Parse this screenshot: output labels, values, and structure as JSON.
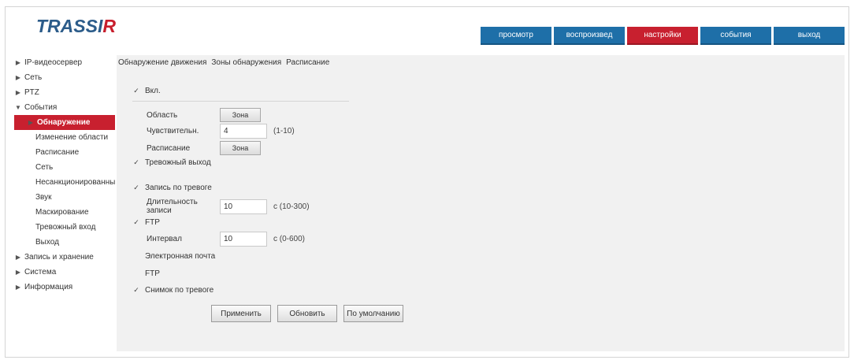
{
  "app": {
    "logo_main": "TRASSI",
    "logo_accent": "R"
  },
  "topnav": [
    {
      "label": "просмотр",
      "active": false
    },
    {
      "label": "воспроизвед",
      "active": false
    },
    {
      "label": "настройки",
      "active": true
    },
    {
      "label": "события",
      "active": false
    },
    {
      "label": "выход",
      "active": false
    }
  ],
  "sidebar": {
    "items": [
      {
        "label": "IP-видеосервер",
        "level": 1,
        "toggle": "▶"
      },
      {
        "label": "Сеть",
        "level": 1,
        "toggle": "▶"
      },
      {
        "label": "PTZ",
        "level": 1,
        "toggle": "▶"
      },
      {
        "label": "События",
        "level": 1,
        "toggle": "▼"
      },
      {
        "label": "Обнаружение",
        "level": 2,
        "toggle": "▶",
        "active": true
      },
      {
        "label": "Изменение области",
        "level": 2
      },
      {
        "label": "Расписание",
        "level": 2
      },
      {
        "label": "Сеть",
        "level": 2
      },
      {
        "label": "Несанкционированный",
        "level": 2
      },
      {
        "label": "Звук",
        "level": 2
      },
      {
        "label": "Маскирование",
        "level": 2
      },
      {
        "label": "Тревожный вход",
        "level": 2
      },
      {
        "label": "Выход",
        "level": 2
      },
      {
        "label": "Запись и хранение",
        "level": 1,
        "toggle": "▶"
      },
      {
        "label": "Система",
        "level": 1,
        "toggle": "▶"
      },
      {
        "label": "Информация",
        "level": 1,
        "toggle": "▶"
      }
    ]
  },
  "breadcrumb": {
    "parts": [
      "Обнаружение движения",
      "Зоны обнаружения",
      "Расписание"
    ]
  },
  "form": {
    "enable": {
      "label": "Вкл.",
      "checked": true
    },
    "area": {
      "label": "Область",
      "button": "Зона"
    },
    "sensitivity": {
      "label": "Чувствительн.",
      "value": "4",
      "hint": "(1-10)"
    },
    "schedule": {
      "label": "Расписание",
      "button": "Зона"
    },
    "trigger_alarm": {
      "label": "Тревожный выход",
      "checked": true
    },
    "trigger_record": {
      "label": "Запись по тревоге",
      "checked": true
    },
    "record_duration": {
      "label": "Длительность записи",
      "value": "10",
      "hint": "с (10-300)"
    },
    "ftp": {
      "label": "FTP",
      "checked": true
    },
    "ftp_interval": {
      "label": "Интервал",
      "value": "10",
      "hint": "с (0-600)"
    },
    "email": {
      "label": "Электронная почта",
      "checked": false
    },
    "ftp2": {
      "label": "FTP",
      "checked": false
    },
    "snapshot": {
      "label": "Снимок по тревоге",
      "checked": true
    }
  },
  "actions": {
    "apply": "Применить",
    "refresh": "Обновить",
    "default": "По умолчанию"
  },
  "colors": {
    "brand_blue": "#1e6fa8",
    "accent_red": "#c8202f"
  }
}
